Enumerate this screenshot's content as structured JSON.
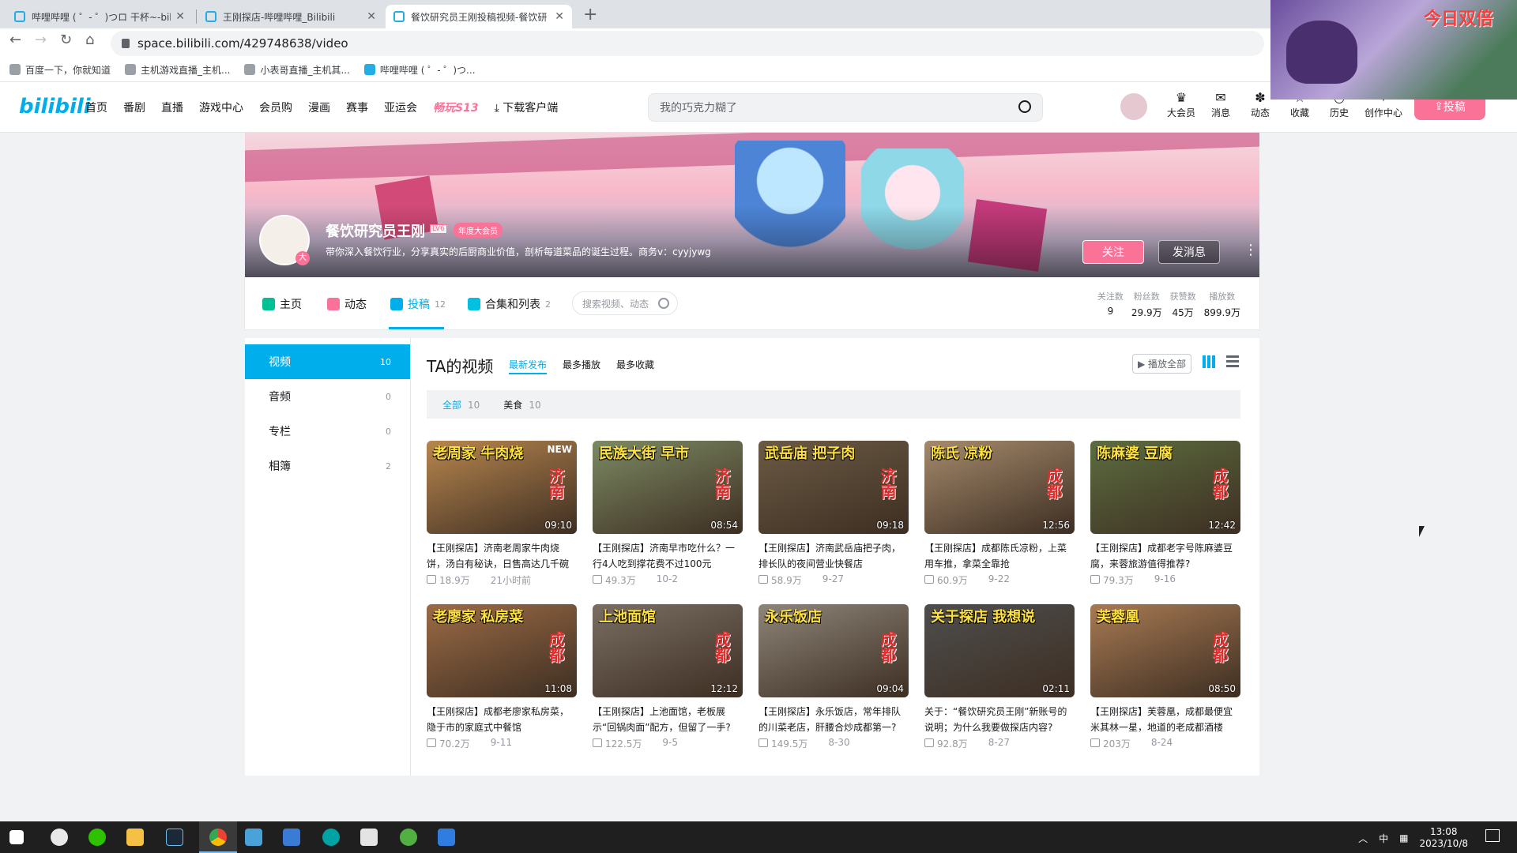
{
  "browser": {
    "tabs": [
      {
        "title": "哔哩哔哩 ( ゜- ゜)つロ 干杯~-bili"
      },
      {
        "title": "王刚探店-哔哩哔哩_Bilibili"
      },
      {
        "title": "餐饮研究员王刚投稿视频-餐饮研"
      }
    ],
    "url": "space.bilibili.com/429748638/video",
    "bookmarks": [
      "百度一下，你就知道",
      "主机游戏直播_主机...",
      "小表哥直播_主机其...",
      "哔哩哔哩 ( ゜- ゜)つ..."
    ]
  },
  "header": {
    "logo": "bilibili",
    "nav": [
      "首页",
      "番剧",
      "直播",
      "游戏中心",
      "会员购",
      "漫画",
      "赛事",
      "亚运会"
    ],
    "nav_special": "畅玩S13",
    "download": "下载客户端",
    "search_placeholder": "我的巧克力糊了",
    "right_items": [
      "大会员",
      "消息",
      "动态",
      "收藏",
      "历史",
      "创作中心"
    ],
    "upload": "投稿"
  },
  "floating_video": {
    "caption": "今日双倍"
  },
  "profile": {
    "name": "餐饮研究员王刚",
    "level": "LV6",
    "vip": "年度大会员",
    "avatar_badge": "大",
    "sign": "带你深入餐饮行业，分享真实的后厨商业价值，剖析每道菜品的诞生过程。商务v：cyyjywg",
    "follow": "关注",
    "message": "发消息"
  },
  "profile_nav": {
    "items": [
      {
        "label": "主页",
        "count": ""
      },
      {
        "label": "动态",
        "count": ""
      },
      {
        "label": "投稿",
        "count": "12"
      },
      {
        "label": "合集和列表",
        "count": "2"
      }
    ],
    "search_placeholder": "搜索视频、动态",
    "stats": [
      {
        "label": "关注数",
        "value": "9"
      },
      {
        "label": "粉丝数",
        "value": "29.9万"
      },
      {
        "label": "获赞数",
        "value": "45万"
      },
      {
        "label": "播放数",
        "value": "899.9万"
      }
    ]
  },
  "sidebar": [
    {
      "label": "视频",
      "count": "10"
    },
    {
      "label": "音频",
      "count": "0"
    },
    {
      "label": "专栏",
      "count": "0"
    },
    {
      "label": "相簿",
      "count": "2"
    }
  ],
  "videos_section": {
    "title": "TA的视频",
    "sorts": [
      "最新发布",
      "最多播放",
      "最多收藏"
    ],
    "play_all": "播放全部",
    "filters": [
      {
        "label": "全部",
        "count": "10"
      },
      {
        "label": "美食",
        "count": "10"
      }
    ]
  },
  "videos": [
    {
      "caption": "老周家 牛肉烧",
      "city": "济南",
      "duration": "09:10",
      "new": "NEW",
      "title": "【王刚探店】济南老周家牛肉烧饼，汤白有秘诀，日售高达几千碗",
      "plays": "18.9万",
      "date": "21小时前",
      "color": "#b8864e"
    },
    {
      "caption": "民族大街 早市",
      "city": "济南",
      "duration": "08:54",
      "new": "",
      "title": "【王刚探店】济南早市吃什么？一行4人吃到撑花费不过100元",
      "plays": "49.3万",
      "date": "10-2",
      "color": "#7c8a63"
    },
    {
      "caption": "武岳庙 把子肉",
      "city": "济南",
      "duration": "09:18",
      "new": "",
      "title": "【王刚探店】济南武岳庙把子肉，排长队的夜间营业快餐店",
      "plays": "58.9万",
      "date": "9-27",
      "color": "#6b5a44"
    },
    {
      "caption": "陈氏 凉粉",
      "city": "成都",
      "duration": "12:56",
      "new": "",
      "title": "【王刚探店】成都陈氏凉粉，上菜用车推，拿菜全靠抢",
      "plays": "60.9万",
      "date": "9-22",
      "color": "#a58a6c"
    },
    {
      "caption": "陈麻婆 豆腐",
      "city": "成都",
      "duration": "12:42",
      "new": "",
      "title": "【王刚探店】成都老字号陈麻婆豆腐，来蓉旅游值得推荐?",
      "plays": "79.3万",
      "date": "9-16",
      "color": "#5c6d3f"
    },
    {
      "caption": "老廖家 私房菜",
      "city": "成都",
      "duration": "11:08",
      "new": "",
      "title": "【王刚探店】成都老廖家私房菜，隐于市的家庭式中餐馆",
      "plays": "70.2万",
      "date": "9-11",
      "color": "#9c6b45"
    },
    {
      "caption": "上池面馆",
      "city": "成都",
      "duration": "12:12",
      "new": "",
      "title": "【王刚探店】上池面馆，老板展示“回锅肉面”配方，但留了一手?",
      "plays": "122.5万",
      "date": "9-5",
      "color": "#7a6e62"
    },
    {
      "caption": "永乐饭店",
      "city": "成都",
      "duration": "09:04",
      "new": "",
      "title": "【王刚探店】永乐饭店，常年排队的川菜老店，肝腰合炒成都第一?",
      "plays": "149.5万",
      "date": "8-30",
      "color": "#8d8578"
    },
    {
      "caption": "关于探店 我想说",
      "city": "",
      "duration": "02:11",
      "new": "",
      "title": "关于：“餐饮研究员王刚”新账号的说明；为什么我要做探店内容?",
      "plays": "92.8万",
      "date": "8-27",
      "color": "#4e4e4e"
    },
    {
      "caption": "芙蓉凰",
      "city": "成都",
      "duration": "08:50",
      "new": "",
      "title": "【王刚探店】芙蓉凰，成都最便宜米其林一星，地道的老成都酒楼",
      "plays": "203万",
      "date": "8-24",
      "color": "#a87a53"
    }
  ],
  "taskbar": {
    "time": "13:08",
    "date": "2023/10/8",
    "ime": "中"
  }
}
